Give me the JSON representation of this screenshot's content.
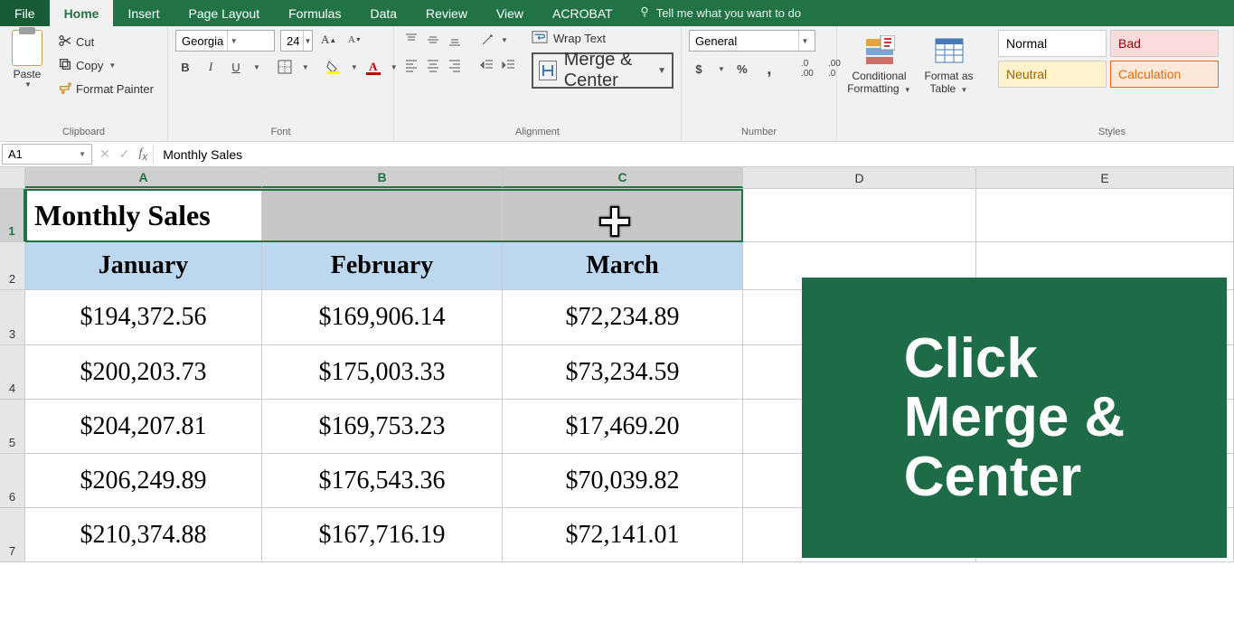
{
  "tabs": {
    "file": "File",
    "home": "Home",
    "insert": "Insert",
    "page_layout": "Page Layout",
    "formulas": "Formulas",
    "data": "Data",
    "review": "Review",
    "view": "View",
    "acrobat": "ACROBAT",
    "tellme": "Tell me what you want to do"
  },
  "ribbon": {
    "clipboard": {
      "paste": "Paste",
      "cut": "Cut",
      "copy": "Copy",
      "format_painter": "Format Painter",
      "label": "Clipboard"
    },
    "font": {
      "name": "Georgia",
      "size": "24",
      "label": "Font",
      "bold": "B",
      "italic": "I",
      "underline": "U",
      "increase": "A",
      "decrease": "A",
      "fontcolor_letter": "A",
      "fillcolor_letter": ""
    },
    "alignment": {
      "wrap": "Wrap Text",
      "merge": "Merge & Center",
      "label": "Alignment"
    },
    "number": {
      "format": "General",
      "pct": "%",
      "comma": ",",
      "label": "Number"
    },
    "cond_fmt": "Conditional Formatting",
    "fmt_table": "Format as Table",
    "styles": {
      "normal": "Normal",
      "bad": "Bad",
      "neutral": "Neutral",
      "calc": "Calculation",
      "label": "Styles"
    }
  },
  "formula_bar": {
    "name_box": "A1",
    "formula": "Monthly Sales"
  },
  "columns": {
    "A": "A",
    "B": "B",
    "C": "C",
    "D": "D",
    "E": "E"
  },
  "rows": {
    "r1": "1",
    "r2": "2",
    "r3": "3",
    "r4": "4",
    "r5": "5",
    "r6": "6",
    "r7": "7"
  },
  "sheet": {
    "title": "Monthly Sales",
    "headers": {
      "jan": "January",
      "feb": "February",
      "mar": "March"
    },
    "data": [
      {
        "jan": "$194,372.56",
        "feb": "$169,906.14",
        "mar": "$72,234.89"
      },
      {
        "jan": "$200,203.73",
        "feb": "$175,003.33",
        "mar": "$73,234.59"
      },
      {
        "jan": "$204,207.81",
        "feb": "$169,753.23",
        "mar": "$17,469.20"
      },
      {
        "jan": "$206,249.89",
        "feb": "$176,543.36",
        "mar": "$70,039.82"
      },
      {
        "jan": "$210,374.88",
        "feb": "$167,716.19",
        "mar": "$72,141.01"
      }
    ]
  },
  "tutorial": {
    "line1": "Click",
    "line2": "Merge &",
    "line3": "Center"
  },
  "col_widths": {
    "A": 262,
    "B": 266,
    "C": 266,
    "D": 258,
    "E": 285
  },
  "row_heights": {
    "r1": 59,
    "r2": 53,
    "r3": 61,
    "r4": 60,
    "r5": 60,
    "r6": 60,
    "r7": 60
  },
  "chart_data": {
    "type": "table",
    "title": "Monthly Sales",
    "categories": [
      "January",
      "February",
      "March"
    ],
    "series": [
      {
        "name": "Row 3",
        "values": [
          194372.56,
          169906.14,
          72234.89
        ]
      },
      {
        "name": "Row 4",
        "values": [
          200203.73,
          175003.33,
          73234.59
        ]
      },
      {
        "name": "Row 5",
        "values": [
          204207.81,
          169753.23,
          17469.2
        ]
      },
      {
        "name": "Row 6",
        "values": [
          206249.89,
          176543.36,
          70039.82
        ]
      },
      {
        "name": "Row 7",
        "values": [
          210374.88,
          167716.19,
          72141.01
        ]
      }
    ]
  }
}
